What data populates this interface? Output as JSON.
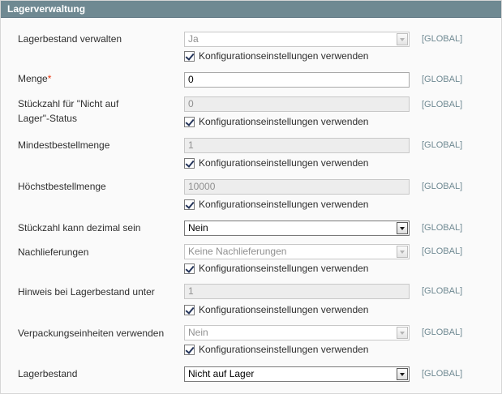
{
  "panel": {
    "title": "Lagerverwaltung"
  },
  "scope_label": "[GLOBAL]",
  "config_label": "Konfigurationseinstellungen verwenden",
  "rows": {
    "manage_stock": {
      "label": "Lagerbestand verwalten",
      "value": "Ja"
    },
    "qty": {
      "label": "Menge",
      "required_mark": "*",
      "value": "0"
    },
    "min_qty": {
      "label_line1": "Stückzahl für \"Nicht auf",
      "label_line2": "Lager\"-Status",
      "value": "0"
    },
    "min_sale_qty": {
      "label": "Mindestbestellmenge",
      "value": "1"
    },
    "max_sale_qty": {
      "label": "Höchstbestellmenge",
      "value": "10000"
    },
    "is_qty_decimal": {
      "label": "Stückzahl kann dezimal sein",
      "value": "Nein"
    },
    "backorders": {
      "label": "Nachlieferungen",
      "value": "Keine Nachlieferungen"
    },
    "notify_stock_qty": {
      "label": "Hinweis bei Lagerbestand unter",
      "value": "1"
    },
    "enable_qty_increments": {
      "label": "Verpackungseinheiten verwenden",
      "value": "Nein"
    },
    "stock_status": {
      "label": "Lagerbestand",
      "value": "Nicht auf Lager"
    }
  }
}
